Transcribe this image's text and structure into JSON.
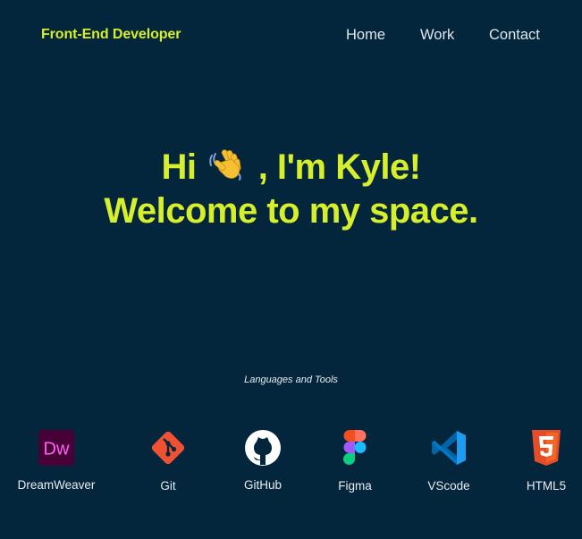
{
  "header": {
    "brand": "Front-End Developer",
    "nav": [
      {
        "label": "Home"
      },
      {
        "label": "Work"
      },
      {
        "label": "Contact"
      }
    ]
  },
  "hero": {
    "line1_before": "Hi",
    "line1_icon": "waving-hand-icon",
    "line1_after": ", I'm Kyle!",
    "line2": "Welcome to my space."
  },
  "tools": {
    "heading": "Languages and Tools",
    "items": [
      {
        "label": "DreamWeaver",
        "icon": "dreamweaver-icon"
      },
      {
        "label": "Git",
        "icon": "git-icon"
      },
      {
        "label": "GitHub",
        "icon": "github-icon"
      },
      {
        "label": "Figma",
        "icon": "figma-icon"
      },
      {
        "label": "VScode",
        "icon": "vscode-icon"
      },
      {
        "label": "HTML5",
        "icon": "html5-icon"
      }
    ]
  },
  "colors": {
    "background": "#03263c",
    "accent": "#d7ee2b",
    "text": "#dfe6ec"
  }
}
